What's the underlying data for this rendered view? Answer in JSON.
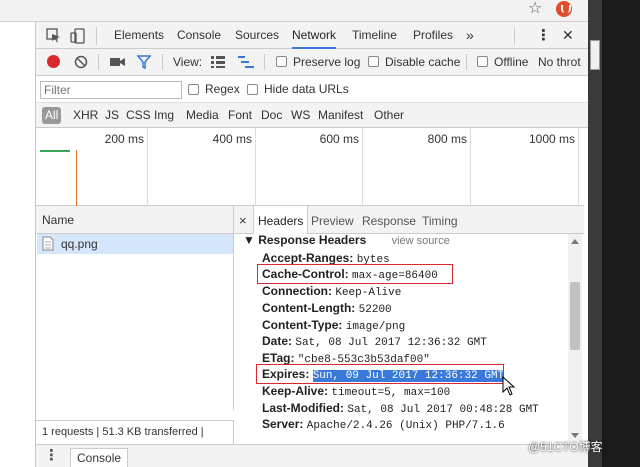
{
  "devtools": {
    "tabs": [
      "Elements",
      "Console",
      "Sources",
      "Network",
      "Timeline",
      "Profiles"
    ],
    "active_tab": "Network",
    "more_glyph": "»",
    "menu_glyph": "⋮",
    "close_glyph": "✕"
  },
  "toolbar": {
    "view_label": "View:",
    "preserve_log": "Preserve log",
    "disable_cache": "Disable cache",
    "offline": "Offline",
    "throttle": "No throt"
  },
  "filter": {
    "placeholder": "Filter",
    "regex": "Regex",
    "hide_data_urls": "Hide data URLs"
  },
  "types": [
    "All",
    "XHR",
    "JS",
    "CSS",
    "Img",
    "Media",
    "Font",
    "Doc",
    "WS",
    "Manifest",
    "Other"
  ],
  "timeline": {
    "ticks": [
      "200 ms",
      "400 ms",
      "600 ms",
      "800 ms",
      "1000 ms"
    ]
  },
  "requests": {
    "column": "Name",
    "items": [
      {
        "name": "qq.png"
      }
    ],
    "status": "1 requests  |  51.3 KB transferred  |"
  },
  "detail": {
    "close_glyph": "×",
    "tabs": [
      "Headers",
      "Preview",
      "Response",
      "Timing"
    ],
    "active_tab": "Headers",
    "section": "▼ Response Headers",
    "view_source": "view source",
    "headers": [
      {
        "key": "Accept-Ranges:",
        "value": "bytes"
      },
      {
        "key": "Cache-Control:",
        "value": "max-age=86400"
      },
      {
        "key": "Connection:",
        "value": "Keep-Alive"
      },
      {
        "key": "Content-Length:",
        "value": "52200"
      },
      {
        "key": "Content-Type:",
        "value": "image/png"
      },
      {
        "key": "Date:",
        "value": "Sat, 08 Jul 2017 12:36:32 GMT"
      },
      {
        "key": "ETag:",
        "value": "\"cbe8-553c3b53daf00\""
      },
      {
        "key": "Expires:",
        "value": "Sun, 09 Jul 2017 12:36:32 GMT"
      },
      {
        "key": "Keep-Alive:",
        "value": "timeout=5, max=100"
      },
      {
        "key": "Last-Modified:",
        "value": "Sat, 08 Jul 2017 00:48:28 GMT"
      },
      {
        "key": "Server:",
        "value": "Apache/2.4.26 (Unix) PHP/7.1.6"
      }
    ]
  },
  "drawer": {
    "menu_glyph": "⋮",
    "tab": "Console"
  },
  "watermark": "@51CTO博客",
  "colors": {
    "accent": "#3879d9",
    "record": "#d9282e",
    "highlight_box": "#d9282e",
    "selection": "#3879d9"
  }
}
